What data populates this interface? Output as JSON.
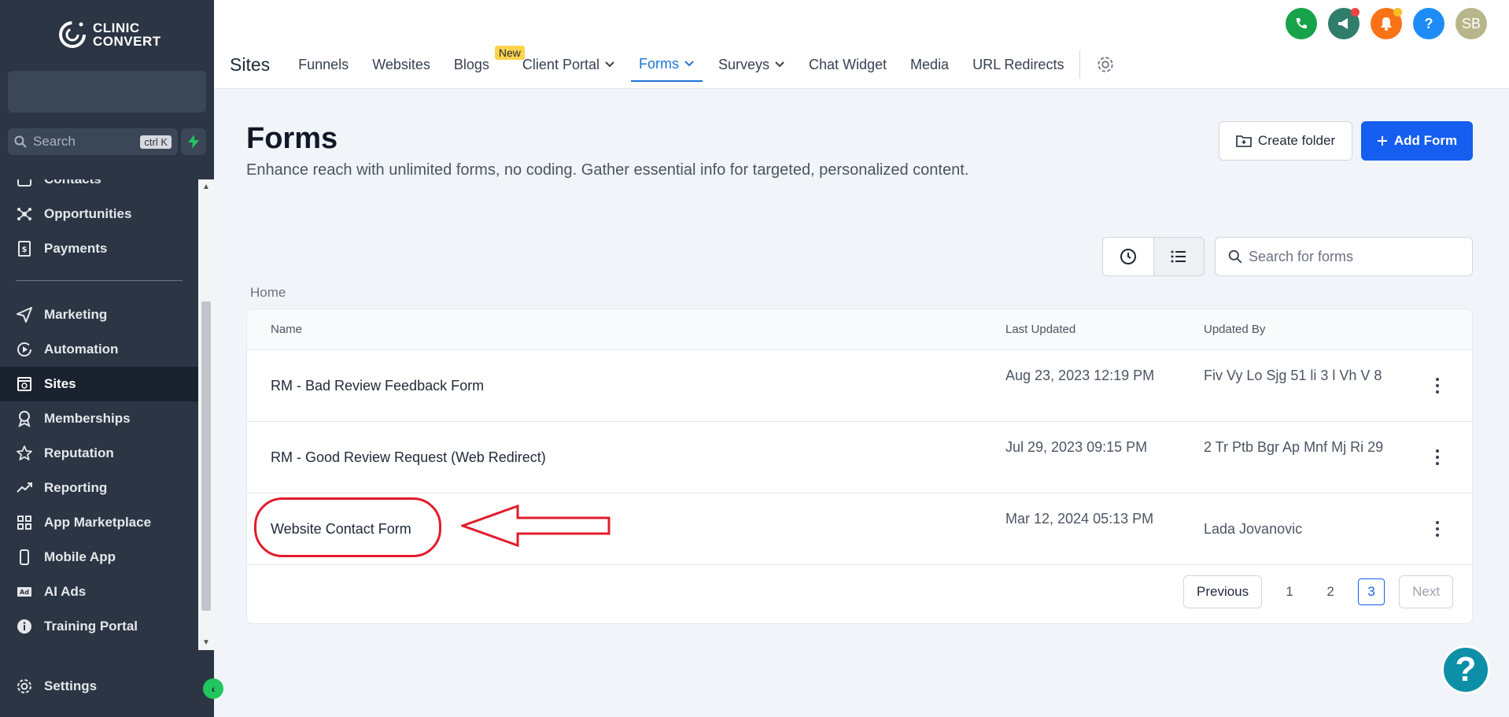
{
  "brand": {
    "line1": "CLINIC",
    "line2": "CONVERT"
  },
  "sidebar": {
    "search_placeholder": "Search",
    "search_shortcut": "ctrl K",
    "items": [
      {
        "label": "Contacts",
        "icon": "contacts-icon"
      },
      {
        "label": "Opportunities",
        "icon": "opportunities-icon"
      },
      {
        "label": "Payments",
        "icon": "payments-icon"
      },
      {
        "label": "Marketing",
        "icon": "send-icon"
      },
      {
        "label": "Automation",
        "icon": "automation-icon"
      },
      {
        "label": "Sites",
        "icon": "sites-icon"
      },
      {
        "label": "Memberships",
        "icon": "memberships-icon"
      },
      {
        "label": "Reputation",
        "icon": "star-icon"
      },
      {
        "label": "Reporting",
        "icon": "trend-icon"
      },
      {
        "label": "App Marketplace",
        "icon": "grid-icon"
      },
      {
        "label": "Mobile App",
        "icon": "phone-icon"
      },
      {
        "label": "AI Ads",
        "icon": "ad-icon"
      },
      {
        "label": "Training Portal",
        "icon": "info-icon"
      }
    ],
    "active": "Sites",
    "settings_label": "Settings"
  },
  "header": {
    "avatar_initials": "SB",
    "help_label": "?",
    "section_title": "Sites",
    "tabs": [
      {
        "label": "Funnels"
      },
      {
        "label": "Websites"
      },
      {
        "label": "Blogs",
        "badge": "New"
      },
      {
        "label": "Client Portal",
        "dropdown": true
      },
      {
        "label": "Forms",
        "dropdown": true,
        "active": true
      },
      {
        "label": "Surveys",
        "dropdown": true
      },
      {
        "label": "Chat Widget"
      },
      {
        "label": "Media"
      },
      {
        "label": "URL Redirects"
      }
    ]
  },
  "main": {
    "title": "Forms",
    "description": "Enhance reach with unlimited forms, no coding. Gather essential info for targeted, personalized content.",
    "create_folder_label": "Create folder",
    "add_form_label": "Add Form",
    "search_placeholder": "Search for forms",
    "breadcrumb": "Home",
    "columns": [
      "Name",
      "Last Updated",
      "Updated By"
    ],
    "rows": [
      {
        "name": "RM - Bad Review Feedback Form",
        "updated": "Aug 23, 2023 12:19 PM",
        "by": "Fiv Vy Lo Sjg 51 li 3 l Vh V 8"
      },
      {
        "name": "RM - Good Review Request (Web Redirect)",
        "updated": "Jul 29, 2023 09:15 PM",
        "by": "2 Tr Ptb Bgr Ap Mnf Mj Ri 29"
      },
      {
        "name": "Website Contact Form",
        "updated": "Mar 12, 2024 05:13 PM",
        "by": "Lada Jovanovic"
      }
    ],
    "pagination": {
      "previous": "Previous",
      "next": "Next",
      "pages": [
        "1",
        "2",
        "3"
      ],
      "current": "3"
    }
  },
  "colors": {
    "sidebar_bg": "#2b3544",
    "primary": "#155eef",
    "active_tab": "#1d74d8",
    "annotation": "#e11d2b"
  }
}
